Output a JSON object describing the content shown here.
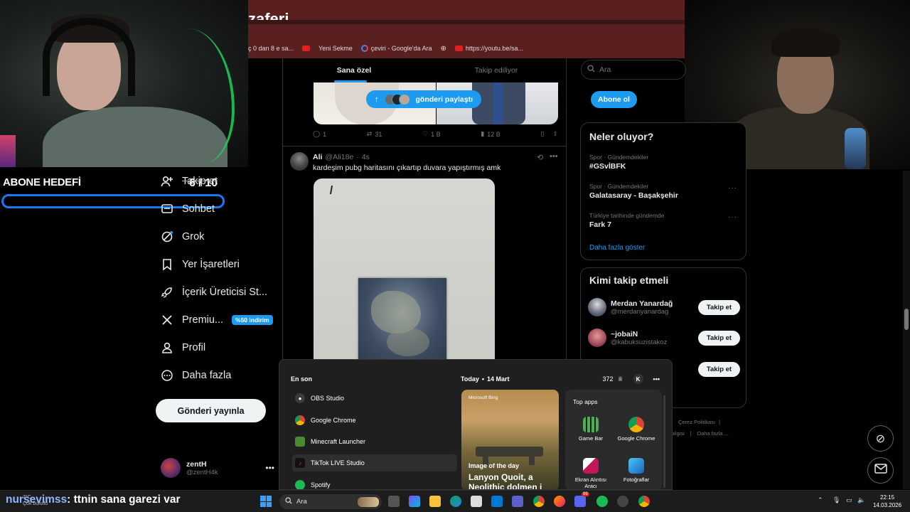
{
  "browser": {
    "title_fragment": "zaferi",
    "bookmarks": [
      {
        "label": "ç 0 dan 8 e sa...",
        "icon": "none"
      },
      {
        "label": "",
        "icon": "youtube-icon"
      },
      {
        "label": "Yeni Sekme",
        "icon": "none"
      },
      {
        "label": "çeviri - Google'da Ara",
        "icon": "google-icon"
      },
      {
        "label": "",
        "icon": "globe-icon"
      },
      {
        "label": "https://youtu.be/sa...",
        "icon": "youtube-icon"
      }
    ]
  },
  "overlay": {
    "goal_label": "ABONE HEDEFİ",
    "goal_count": "6 / 10",
    "goal_progress_fraction": 0.0,
    "chat_user": "nursevimss",
    "chat_message": ": ttnin sana garezi var"
  },
  "nav": {
    "items": [
      {
        "label": "Takip et",
        "icon": "add-user-icon"
      },
      {
        "label": "Sohbet",
        "icon": "chat-icon"
      },
      {
        "label": "Grok",
        "icon": "grok-icon"
      },
      {
        "label": "Yer İşaretleri",
        "icon": "bookmark-icon"
      },
      {
        "label": "İçerik Üreticisi St...",
        "icon": "rocket-icon"
      },
      {
        "label": "Premiu...",
        "icon": "x-logo-icon",
        "badge": "%50 indirim"
      },
      {
        "label": "Profil",
        "icon": "person-icon"
      },
      {
        "label": "Daha fazla",
        "icon": "more-icon"
      }
    ],
    "post_button": "Gönderi yayınla",
    "profile": {
      "name": "zentH",
      "handle": "@zentH4k"
    }
  },
  "feed": {
    "tabs": [
      "Sana özel",
      "Takip ediliyor"
    ],
    "share_pill": "gönderi paylaştı",
    "tweet1": {
      "replies": "1",
      "reposts": "31",
      "likes": "1 B",
      "views": "12 B"
    },
    "tweet2": {
      "name": "Ali",
      "handle": "@Ali18e",
      "time": "4s",
      "text": "kardeşim pubg haritasını çıkartıp duvara yapıştırmış amk"
    }
  },
  "right": {
    "search_placeholder": "Ara",
    "subscribe": "Abone ol",
    "trends_title": "Neler oluyor?",
    "trends": [
      {
        "category": "Spor · Gündemdekiler",
        "name": "#GSvİBFK"
      },
      {
        "category": "Spor · Gündemdekiler",
        "name": "Galatasaray - Başakşehir"
      },
      {
        "category": "Türkiye tarihinde gündemde",
        "name": "Fark 7"
      }
    ],
    "show_more": "Daha fazla göster",
    "who_title": "Kimi takip etmeli",
    "who": [
      {
        "name": "Merdan Yanardağ",
        "handle": "@merdanyanardag",
        "button": "Takip et"
      },
      {
        "name": "~jobaiN",
        "handle": "@kabuksuzistakoz",
        "button": "Takip et"
      },
      {
        "name": "",
        "handle": "",
        "button": "Takip et"
      }
    ],
    "footer": [
      "Çerez Politikası",
      "bilgisi",
      "Daha fazla ..."
    ]
  },
  "start_menu": {
    "recent_title": "En son",
    "recent": [
      {
        "label": "OBS Studio",
        "color": "#3a3a3a"
      },
      {
        "label": "Google Chrome",
        "color": "#db4437"
      },
      {
        "label": "Minecraft Launcher",
        "color": "#4c8a2f"
      },
      {
        "label": "TikTok LIVE Studio",
        "color": "#fe2c55"
      },
      {
        "label": "Spotify",
        "color": "#1db954"
      }
    ],
    "today": "Today",
    "date": "14 Mart",
    "points": "372",
    "user_initial": "K",
    "news_source": "Microsoft Bing",
    "news_caption": "Image of the day",
    "news_title": "Lanyon Quoit, a Neolithic dolmen i",
    "top_apps_title": "Top apps",
    "top_apps": [
      {
        "label": "Game Bar",
        "color": "#4caf50"
      },
      {
        "label": "Google Chrome",
        "color": "#db4437"
      },
      {
        "label": "Ekran Alıntısı Aracı",
        "color": "#c2185b"
      },
      {
        "label": "Fotoğraflar",
        "color": "#1e88e5"
      }
    ]
  },
  "taskbar": {
    "search_placeholder": "Ara",
    "weather_temp": "7°C",
    "weather_desc": "Çok bulutlu",
    "time": "22:15",
    "date": "14.03.2026",
    "notification_count": "99"
  }
}
